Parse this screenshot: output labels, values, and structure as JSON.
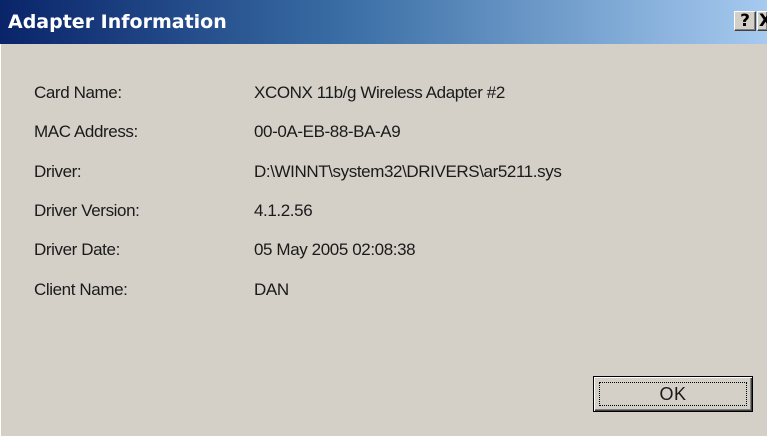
{
  "window": {
    "title": "Adapter Information",
    "help_glyph": "?",
    "close_glyph": "X",
    "colors": {
      "titlebar_start": "#0a246a",
      "titlebar_end": "#a6caf0",
      "face": "#d4d0c8"
    }
  },
  "details": [
    {
      "label": "Card Name:",
      "value": "XCONX 11b/g Wireless Adapter #2"
    },
    {
      "label": "MAC Address:",
      "value": "00-0A-EB-88-BA-A9"
    },
    {
      "label": "Driver:",
      "value": "D:\\WINNT\\system32\\DRIVERS\\ar5211.sys"
    },
    {
      "label": "Driver Version:",
      "value": "4.1.2.56"
    },
    {
      "label": "Driver Date:",
      "value": "05 May 2005 02:08:38"
    },
    {
      "label": "Client Name:",
      "value": "DAN"
    }
  ],
  "buttons": {
    "ok_label": "OK"
  }
}
